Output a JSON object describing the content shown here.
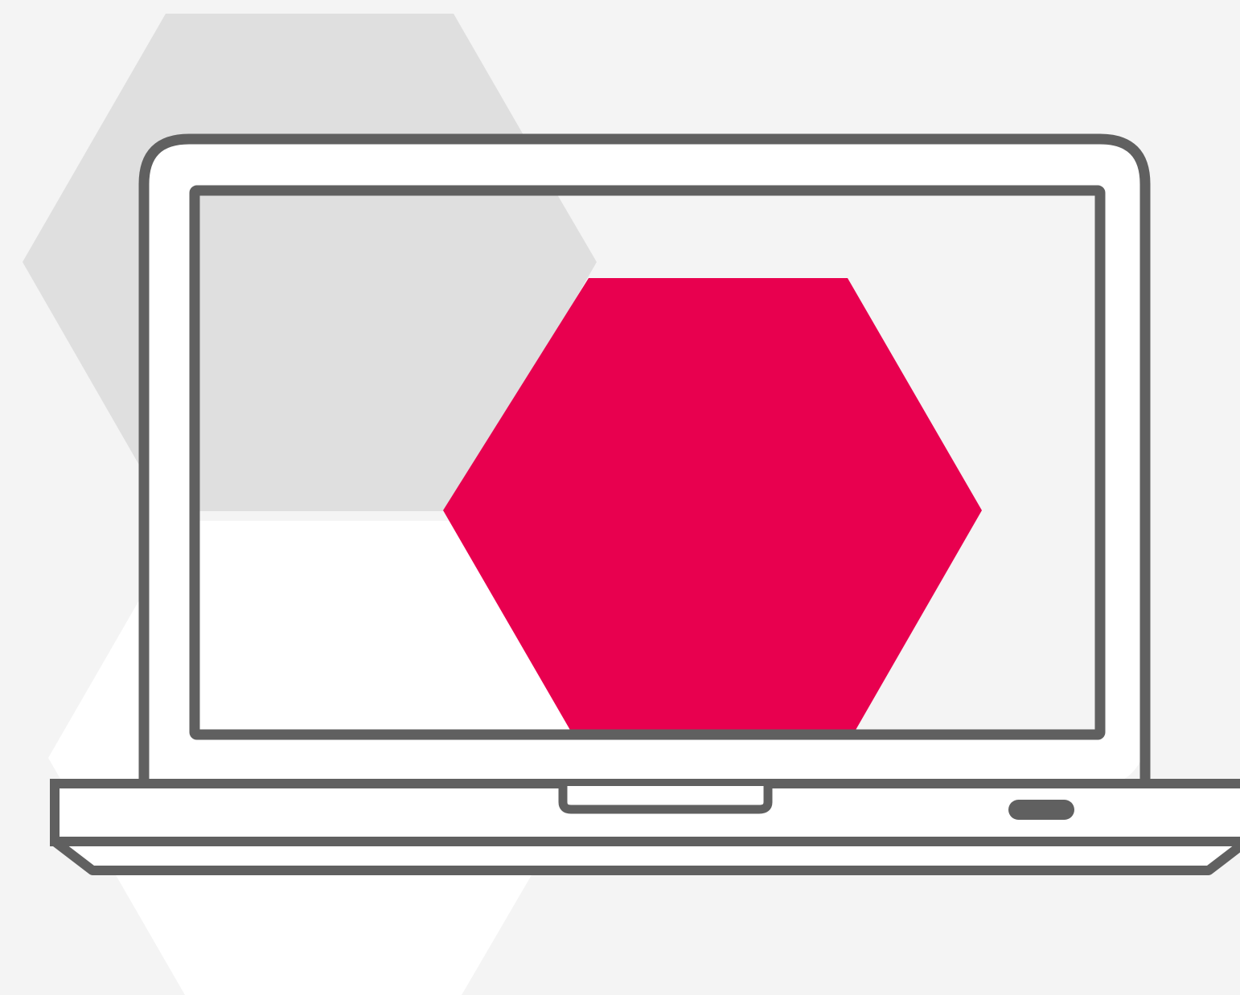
{
  "illustration": {
    "subject": "laptop-with-hexagons",
    "colors": {
      "background": "#f4f4f4",
      "hexagon_gray": "#dfdfdf",
      "hexagon_white": "#ffffff",
      "hexagon_accent": "#e8004f",
      "laptop_outline": "#606060",
      "laptop_fill": "#ffffff"
    }
  }
}
